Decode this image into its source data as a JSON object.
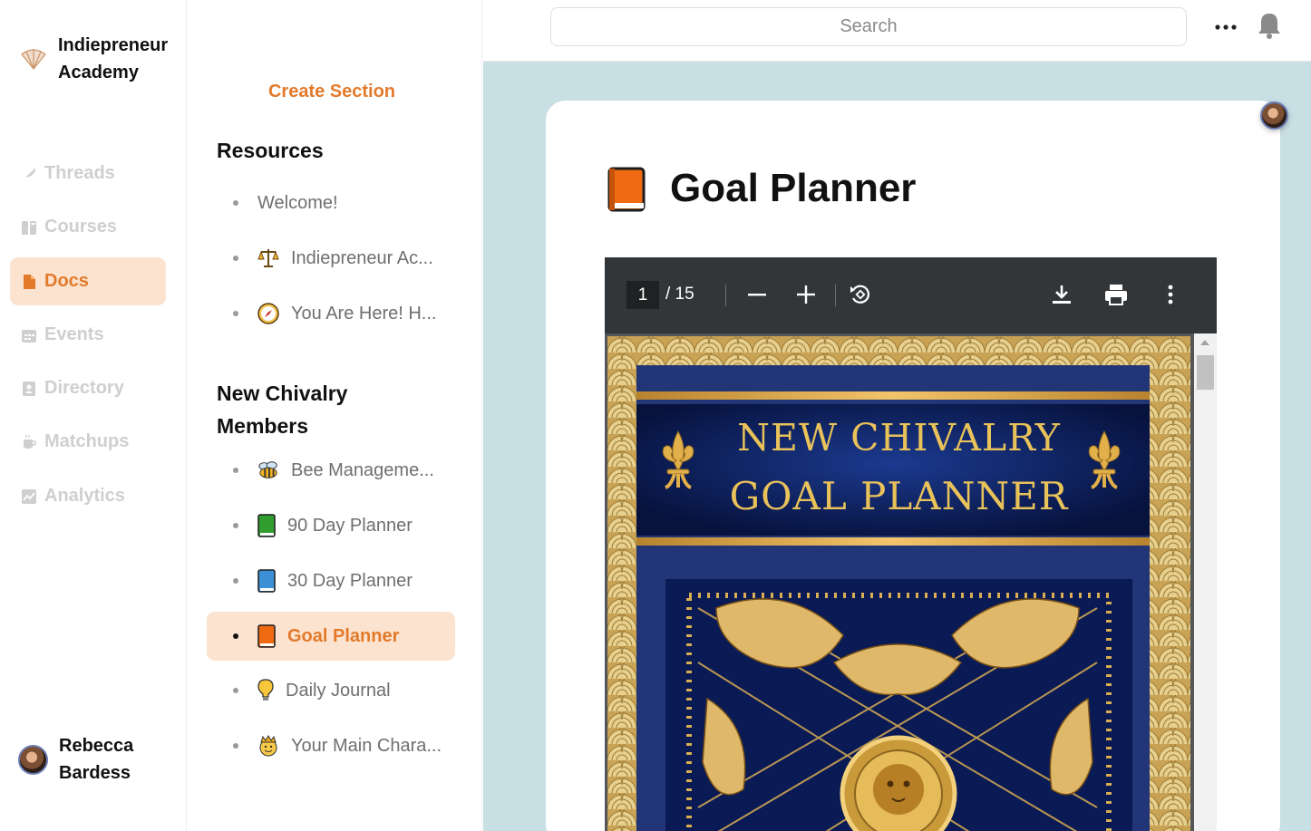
{
  "brand": {
    "name": "Indiepreneur Academy",
    "logo_icon": "shell-logo-icon"
  },
  "nav": {
    "items": [
      {
        "label": "Threads",
        "icon": "feather-icon",
        "active": false
      },
      {
        "label": "Courses",
        "icon": "courses-icon",
        "active": false
      },
      {
        "label": "Docs",
        "icon": "doc-icon",
        "active": true
      },
      {
        "label": "Events",
        "icon": "calendar-icon",
        "active": false
      },
      {
        "label": "Directory",
        "icon": "directory-icon",
        "active": false
      },
      {
        "label": "Matchups",
        "icon": "cup-icon",
        "active": false
      },
      {
        "label": "Analytics",
        "icon": "chart-icon",
        "active": false
      }
    ]
  },
  "user": {
    "name": "Rebecca Bardess"
  },
  "docs_sidebar": {
    "create_label": "Create Section",
    "sections": [
      {
        "title": "Resources",
        "items": [
          {
            "label": "Welcome!",
            "icon": ""
          },
          {
            "label": "Indiepreneur Ac...",
            "icon": "scales-icon"
          },
          {
            "label": "You Are Here! H...",
            "icon": "compass-icon"
          }
        ]
      },
      {
        "title": "New Chivalry Members",
        "items": [
          {
            "label": "Bee Manageme...",
            "icon": "bee-icon"
          },
          {
            "label": "90 Day Planner",
            "icon": "green-book-icon"
          },
          {
            "label": "30 Day Planner",
            "icon": "blue-book-icon"
          },
          {
            "label": "Goal Planner",
            "icon": "orange-book-icon",
            "active": true
          },
          {
            "label": "Daily Journal",
            "icon": "lightbulb-icon"
          },
          {
            "label": "Your Main Chara...",
            "icon": "crown-face-icon"
          }
        ]
      }
    ]
  },
  "topbar": {
    "search_placeholder": "Search"
  },
  "doc": {
    "title": "Goal Planner",
    "icon": "orange-book-icon"
  },
  "pdf": {
    "current_page": "1",
    "total_label": "/ 15",
    "cover_line1": "NEW CHIVALRY",
    "cover_line2": "GOAL PLANNER"
  },
  "colors": {
    "accent": "#e37a2b",
    "accent_bg": "#fbe3cf",
    "content_bg": "#c8dfe4",
    "pdf_toolbar": "#323639",
    "cover_navy": "#1e2f6e",
    "cover_gold": "#e9c25a"
  }
}
